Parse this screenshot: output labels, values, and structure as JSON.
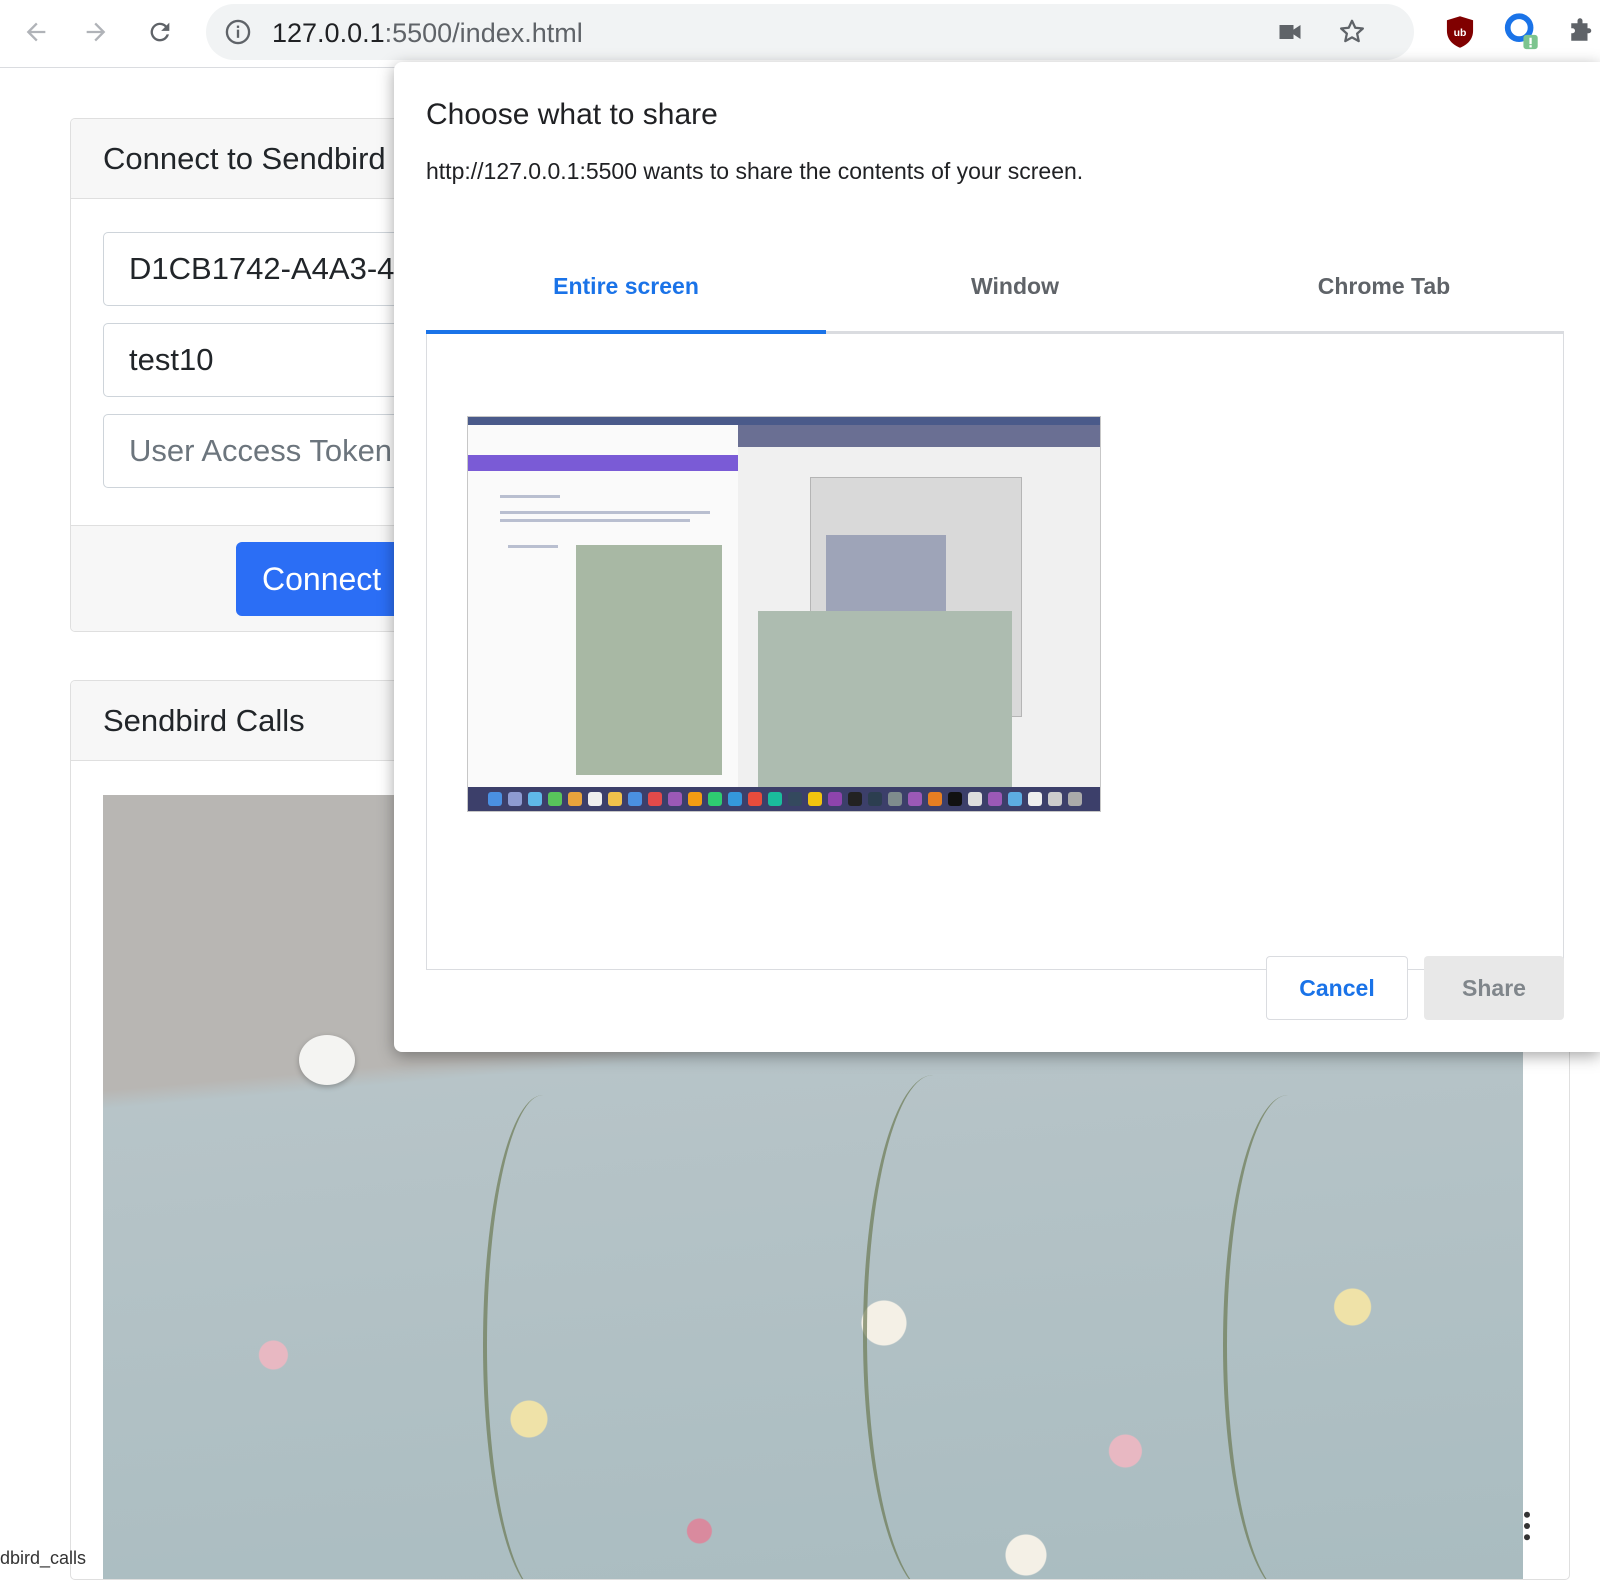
{
  "browser": {
    "url_host": "127.0.0.1",
    "url_path": ":5500/index.html"
  },
  "connect_card": {
    "title": "Connect to Sendbird",
    "app_id_value": "D1CB1742-A4A3-4",
    "user_id_value": "test10",
    "token_placeholder": "User Access Token",
    "connect_label": "Connect"
  },
  "calls_card": {
    "title": "Sendbird Calls"
  },
  "bottom_text": "dbird_calls",
  "dialog": {
    "title": "Choose what to share",
    "subtitle": "http://127.0.0.1:5500 wants to share the contents of your screen.",
    "tabs": [
      {
        "label": "Entire screen",
        "active": true
      },
      {
        "label": "Window",
        "active": false
      },
      {
        "label": "Chrome Tab",
        "active": false
      }
    ],
    "cancel_label": "Cancel",
    "share_label": "Share"
  },
  "colors": {
    "accent": "#1a73e8",
    "connect_button": "#2b6ef5",
    "ublock_red": "#800000"
  },
  "icons": [
    "back-arrow-icon",
    "forward-arrow-icon",
    "reload-icon",
    "info-icon",
    "camera-icon",
    "star-icon",
    "ublock-icon",
    "extension-icon",
    "puzzle-icon",
    "more-vertical-icon"
  ]
}
